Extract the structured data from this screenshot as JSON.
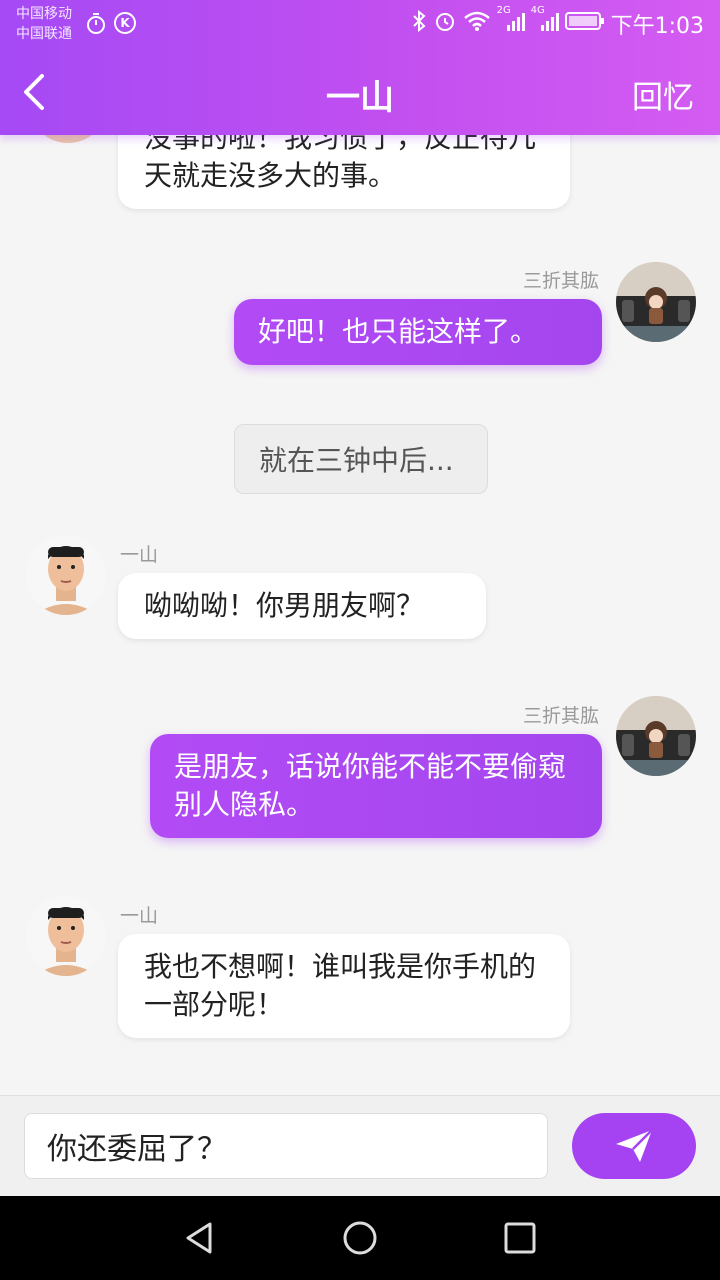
{
  "status": {
    "carrier1": "中国移动",
    "carrier2": "中国联通",
    "net1": "2G",
    "net2": "4G",
    "time": "下午1:03"
  },
  "nav": {
    "title": "一山",
    "right": "回忆"
  },
  "messages": {
    "m1": {
      "text": "没事的啦！我习惯了，反正待几天就走没多大的事。"
    },
    "m2": {
      "sender": "三折其肱",
      "text": "好吧！也只能这样了。"
    },
    "sys": {
      "text": "就在三钟中后..."
    },
    "m3": {
      "sender": "一山",
      "text": "呦呦呦！你男朋友啊？"
    },
    "m4": {
      "sender": "三折其肱",
      "text": "是朋友，话说你能不能不要偷窥别人隐私。"
    },
    "m5": {
      "sender": "一山",
      "text": "我也不想啊！谁叫我是你手机的一部分呢！"
    }
  },
  "input": {
    "value": "你还委屈了？"
  },
  "colors": {
    "accent": "#a543f2",
    "header_start": "#a54af5",
    "header_end": "#d45cf2"
  }
}
